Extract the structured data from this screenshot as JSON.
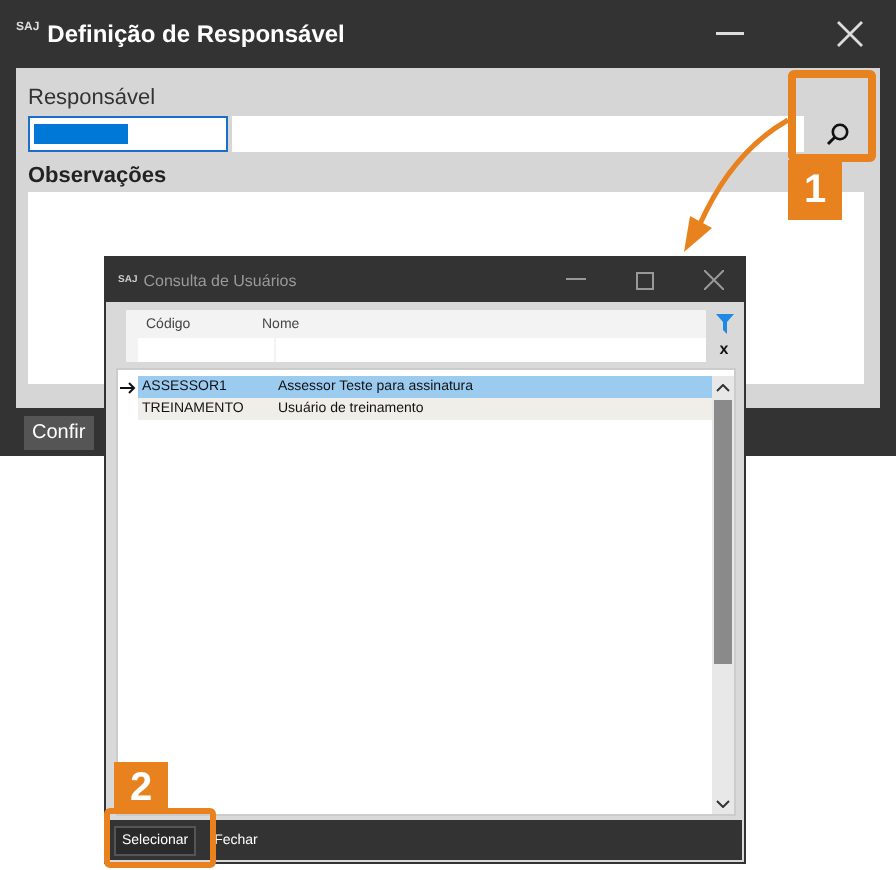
{
  "window": {
    "logo": "SAJ",
    "title": "Definição de Responsável"
  },
  "form": {
    "responsavel_label": "Responsável",
    "code_selected": true,
    "observacoes_label": "Observações",
    "confirm_button": "Confir"
  },
  "dialog": {
    "logo": "SAJ",
    "title": "Consulta de Usuários",
    "columns": [
      "Código",
      "Nome"
    ],
    "filter_clear": "x",
    "rows": [
      {
        "codigo": "ASSESSOR1",
        "nome": "Assessor Teste para assinatura",
        "selected": true
      },
      {
        "codigo": "TREINAMENTO",
        "nome": "Usuário de treinamento",
        "selected": false
      }
    ],
    "buttons": [
      "Selecionar",
      "Fechar"
    ]
  },
  "callouts": [
    "1",
    "2"
  ]
}
